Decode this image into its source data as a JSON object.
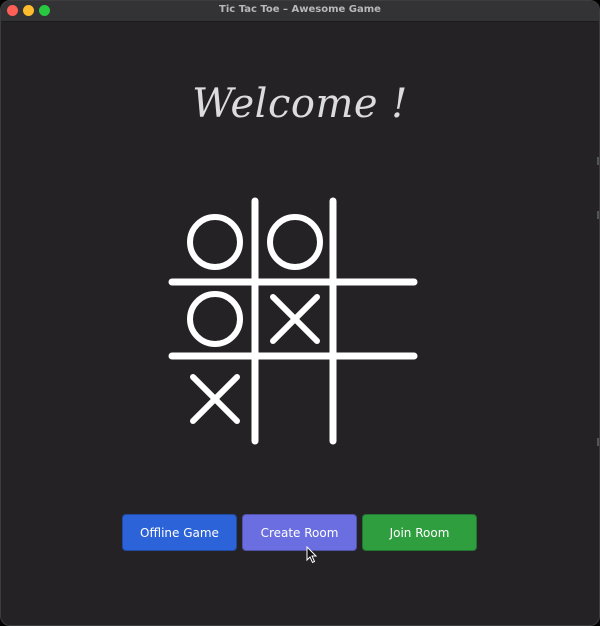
{
  "window": {
    "title": "Tic Tac Toe – Awesome Game"
  },
  "welcome": {
    "text": "Welcome !"
  },
  "board": {
    "cells": [
      [
        "O",
        "O",
        ""
      ],
      [
        "O",
        "X",
        ""
      ],
      [
        "X",
        "",
        ""
      ]
    ],
    "stroke_color": "#ffffff"
  },
  "buttons": {
    "offline": "Offline Game",
    "create": "Create Room",
    "join": "Join Room"
  },
  "colors": {
    "background": "#242225",
    "offline_button": "#2d63d8",
    "create_button": "#6b6ee0",
    "join_button": "#2e9e3f"
  }
}
